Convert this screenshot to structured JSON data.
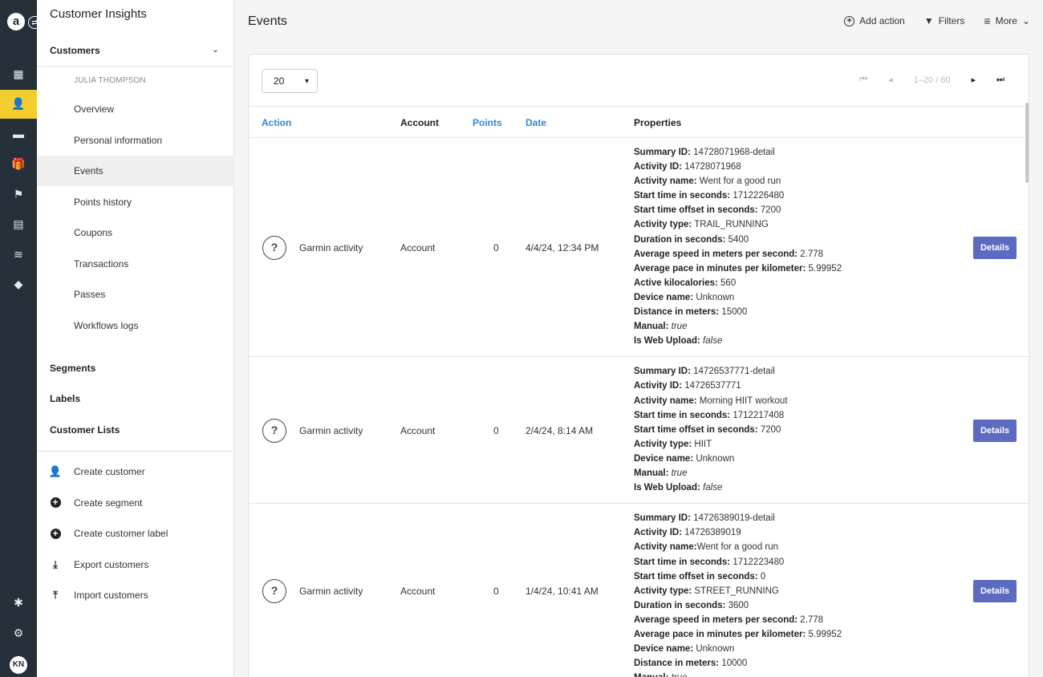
{
  "rail": {
    "logo": "a",
    "switch": "⇄",
    "avatar": "KN",
    "items": [
      {
        "name": "dashboard-icon",
        "glyph": "▦"
      },
      {
        "name": "customers-icon",
        "glyph": "👤"
      },
      {
        "name": "wallet-icon",
        "glyph": "▬"
      },
      {
        "name": "gift-icon",
        "glyph": "🎁"
      },
      {
        "name": "flag-icon",
        "glyph": "⚑"
      },
      {
        "name": "message-icon",
        "glyph": "▤"
      },
      {
        "name": "waves-icon",
        "glyph": "≋"
      },
      {
        "name": "tag-icon",
        "glyph": "◆"
      }
    ],
    "bottom": [
      {
        "name": "puzzle-icon",
        "glyph": "✱"
      },
      {
        "name": "gear-icon",
        "glyph": "⚙"
      }
    ]
  },
  "sidebar": {
    "title": "Customer Insights",
    "customers_label": "Customers",
    "user_name": "JULIA THOMPSON",
    "items": [
      "Overview",
      "Personal information",
      "Events",
      "Points history",
      "Coupons",
      "Transactions",
      "Passes",
      "Workflows logs"
    ],
    "segments_label": "Segments",
    "labels_label": "Labels",
    "customer_lists_label": "Customer Lists",
    "actions": [
      "Create customer",
      "Create segment",
      "Create customer label",
      "Export customers",
      "Import customers"
    ]
  },
  "header": {
    "title": "Events",
    "add_action": "Add action",
    "filters": "Filters",
    "more": "More"
  },
  "table": {
    "page_size": "20",
    "range": "1–20 / 60",
    "columns": [
      "Action",
      "Account",
      "Points",
      "Date",
      "Properties"
    ],
    "details_label": "Details",
    "rows": [
      {
        "action": "Garmin activity",
        "account": "Account",
        "points": "0",
        "date": "4/4/24, 12:34 PM",
        "props": [
          {
            "k": "Summary ID:",
            "v": " 14728071968-detail"
          },
          {
            "k": "Activity ID:",
            "v": " 14728071968"
          },
          {
            "k": "Activity name:",
            "v": " Went for a good run"
          },
          {
            "k": "Start time in seconds:",
            "v": " 1712226480"
          },
          {
            "k": "Start time offset in seconds:",
            "v": " 7200"
          },
          {
            "k": "Activity type:",
            "v": " TRAIL_RUNNING"
          },
          {
            "k": "Duration in seconds:",
            "v": " 5400"
          },
          {
            "k": "Average speed in meters per second:",
            "v": " 2.778"
          },
          {
            "k": "Average pace in minutes per kilometer:",
            "v": " 5.99952"
          },
          {
            "k": "Active kilocalories:",
            "v": " 560"
          },
          {
            "k": "Device name:",
            "v": " Unknown"
          },
          {
            "k": "Distance in meters:",
            "v": " 15000"
          },
          {
            "k": "Manual:",
            "v": " true",
            "i": true
          },
          {
            "k": "Is Web Upload:",
            "v": " false",
            "i": true
          }
        ]
      },
      {
        "action": "Garmin activity",
        "account": "Account",
        "points": "0",
        "date": "2/4/24, 8:14 AM",
        "props": [
          {
            "k": "Summary ID:",
            "v": " 14726537771-detail"
          },
          {
            "k": "Activity ID:",
            "v": " 14726537771"
          },
          {
            "k": "Activity name:",
            "v": " Morning HIIT workout"
          },
          {
            "k": "Start time in seconds:",
            "v": " 1712217408"
          },
          {
            "k": "Start time offset in seconds:",
            "v": " 7200"
          },
          {
            "k": "Activity type:",
            "v": " HIIT"
          },
          {
            "k": "Device name:",
            "v": " Unknown"
          },
          {
            "k": "Manual:",
            "v": " true",
            "i": true
          },
          {
            "k": "Is Web Upload:",
            "v": " false",
            "i": true
          }
        ]
      },
      {
        "action": "Garmin activity",
        "account": "Account",
        "points": "0",
        "date": "1/4/24, 10:41 AM",
        "props": [
          {
            "k": "Summary ID:",
            "v": " 14726389019-detail"
          },
          {
            "k": "Activity ID:",
            "v": " 14726389019"
          },
          {
            "k": "Activity name:",
            "v": "Went for a good run"
          },
          {
            "k": "Start time in seconds:",
            "v": " 1712223480"
          },
          {
            "k": "Start time offset in seconds:",
            "v": " 0"
          },
          {
            "k": "Activity type:",
            "v": " STREET_RUNNING"
          },
          {
            "k": "Duration in seconds:",
            "v": " 3600"
          },
          {
            "k": "Average speed in meters per second:",
            "v": " 2.778"
          },
          {
            "k": "Average pace in minutes per kilometer:",
            "v": " 5.99952"
          },
          {
            "k": "Device name:",
            "v": " Unknown"
          },
          {
            "k": "Distance in meters:",
            "v": " 10000"
          },
          {
            "k": "Manual:",
            "v": " true",
            "i": true
          }
        ]
      }
    ]
  }
}
